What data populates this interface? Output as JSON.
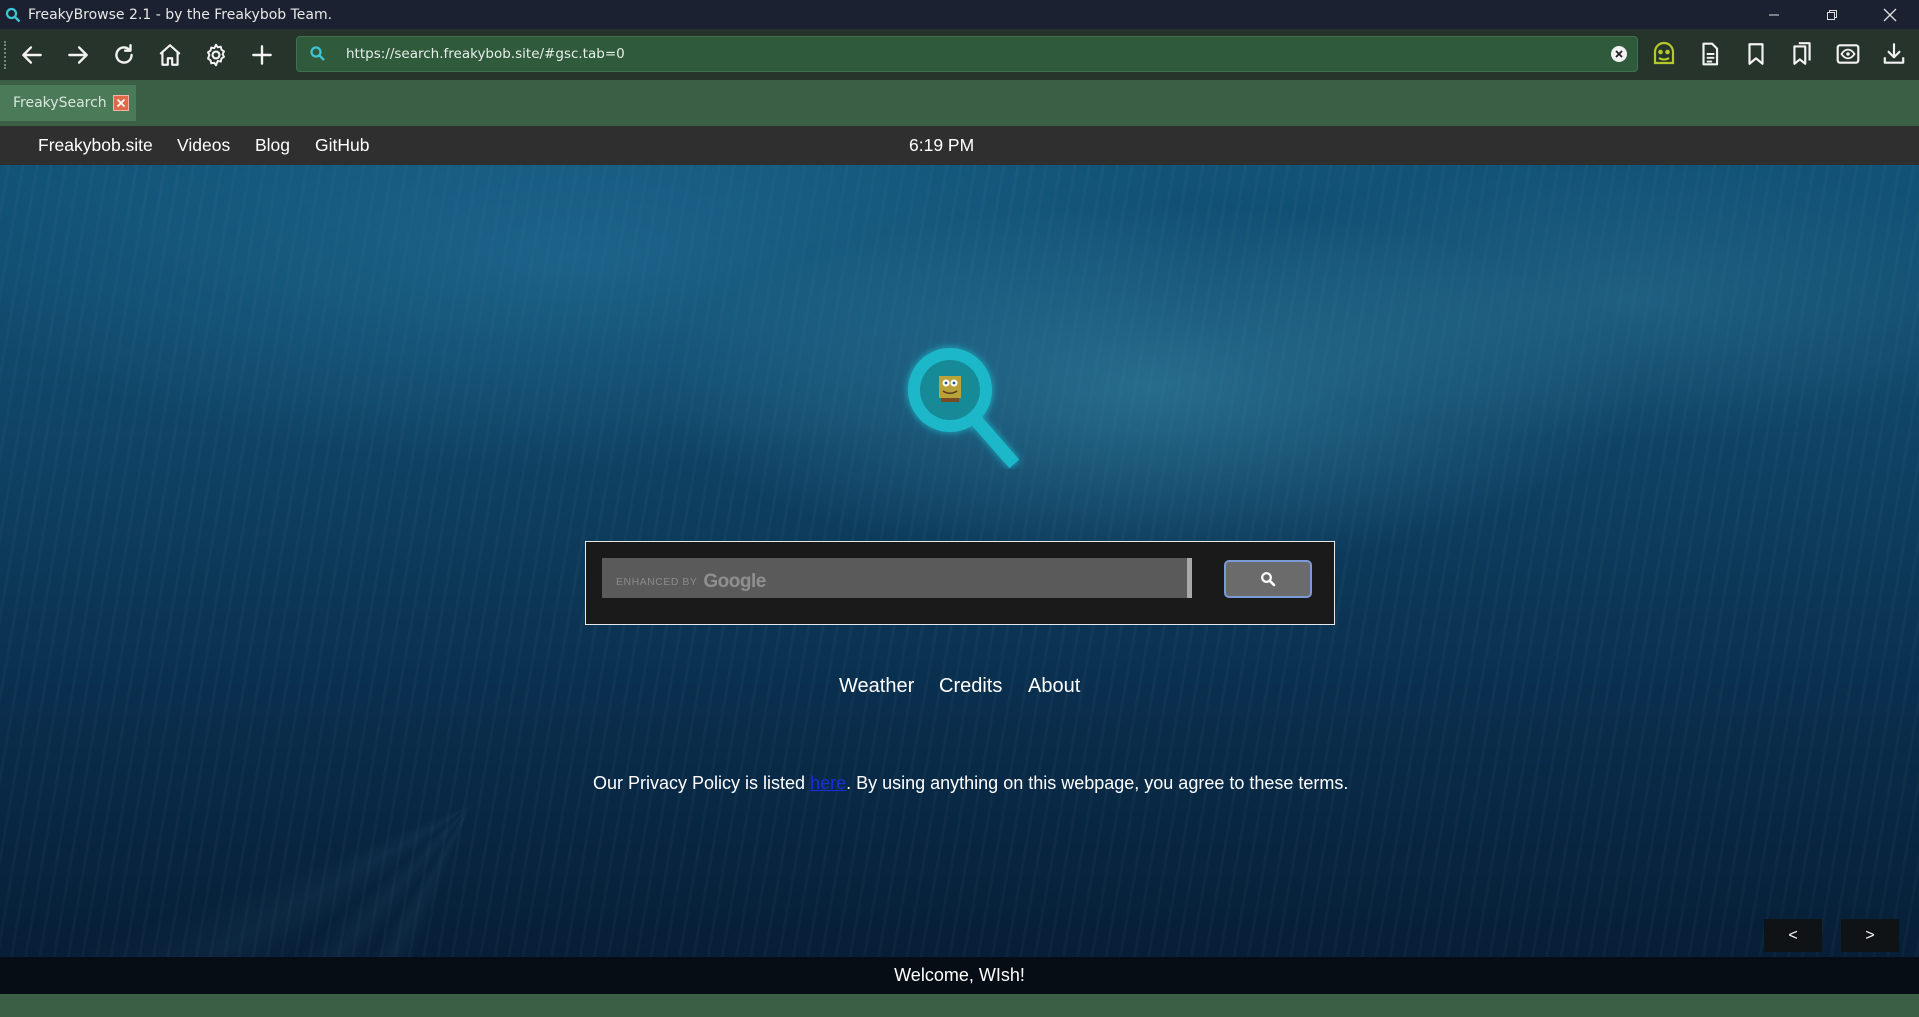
{
  "window": {
    "title": "FreakyBrowse 2.1 - by the Freakybob Team.",
    "controls": [
      "minimize-icon",
      "restore-icon",
      "close-icon"
    ]
  },
  "toolbar": {
    "left_buttons": [
      "back-arrow-icon",
      "forward-arrow-icon",
      "reload-icon",
      "home-icon",
      "gear-icon",
      "plus-icon"
    ],
    "url": "https://search.freakybob.site/#gsc.tab=0",
    "right_buttons": [
      "freakybob-face-icon",
      "document-icon",
      "bookmark-icon",
      "bookmarks-list-icon",
      "reader-view-icon",
      "download-icon"
    ]
  },
  "tabs": [
    {
      "label": "FreakySearch",
      "active": true
    }
  ],
  "page": {
    "nav": {
      "links": [
        "Freakybob.site",
        "Videos",
        "Blog",
        "GitHub"
      ],
      "clock": "6:19 PM"
    },
    "search": {
      "brand_prefix": "ENHANCED BY",
      "brand_name": "Google",
      "button_icon": "search-icon"
    },
    "links": [
      "Weather",
      "Credits",
      "About"
    ],
    "privacy": {
      "before": "Our Privacy Policy is listed ",
      "link": "here",
      "after": ". By using anything on this webpage, you agree to these terms."
    },
    "pager": {
      "prev": "<",
      "next": ">"
    },
    "footer": "Welcome, WIsh!"
  },
  "colors": {
    "titlebar": "#1b2131",
    "toolbar": "#27342c",
    "urlbar": "#2f5a3c",
    "tabstrip": "#3a5f45",
    "accent_teal": "#1fb8c9",
    "freakybob_green": "#b6c92a"
  }
}
